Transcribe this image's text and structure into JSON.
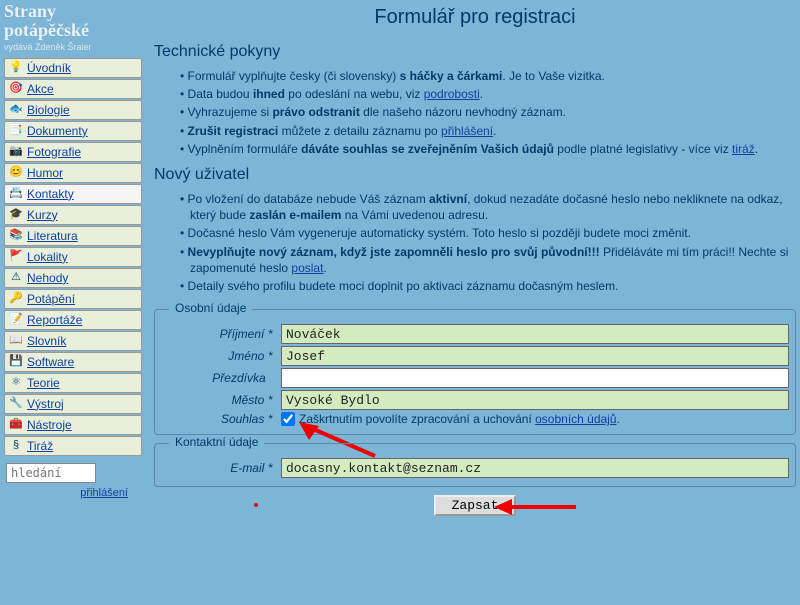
{
  "site": {
    "title_line1": "Strany",
    "title_line2": "potápěčské",
    "subtitle": "vydává Zdeněk Šraier"
  },
  "nav": [
    {
      "icon": "💡",
      "label": "Úvodník"
    },
    {
      "icon": "🎯",
      "label": "Akce"
    },
    {
      "icon": "🐟",
      "label": "Biologie"
    },
    {
      "icon": "📑",
      "label": "Dokumenty"
    },
    {
      "icon": "📷",
      "label": "Fotografie"
    },
    {
      "icon": "😊",
      "label": "Humor"
    },
    {
      "icon": "📇",
      "label": "Kontakty",
      "active": true
    },
    {
      "icon": "🎓",
      "label": "Kurzy"
    },
    {
      "icon": "📚",
      "label": "Literatura"
    },
    {
      "icon": "🚩",
      "label": "Lokality"
    },
    {
      "icon": "⚠",
      "label": "Nehody"
    },
    {
      "icon": "🔑",
      "label": "Potápění"
    },
    {
      "icon": "📝",
      "label": "Reportáže"
    },
    {
      "icon": "📖",
      "label": "Slovník"
    },
    {
      "icon": "💾",
      "label": "Software"
    },
    {
      "icon": "⚛",
      "label": "Teorie"
    },
    {
      "icon": "🔧",
      "label": "Výstroj"
    },
    {
      "icon": "🧰",
      "label": "Nástroje"
    },
    {
      "icon": "§",
      "label": "Tiráž"
    }
  ],
  "search_placeholder": "hledání",
  "login_link": "přihlášení",
  "page_title": "Formulář pro registraci",
  "tech": {
    "heading": "Technické pokyny",
    "li1a": "Formulář vyplňujte česky (či slovensky) ",
    "li1b": "s háčky a čárkami",
    "li1c": ". Je to Vaše vizitka.",
    "li2a": "Data budou ",
    "li2b": "ihned",
    "li2c": " po odeslání na webu, viz ",
    "li2d": "podrobosti",
    "li2e": ".",
    "li3a": "Vyhrazujeme si ",
    "li3b": "právo odstranit",
    "li3c": " dle našeho názoru nevhodný záznam.",
    "li4a": "Zrušit registraci",
    "li4b": " můžete z detailu záznamu po ",
    "li4c": "přihlášení",
    "li4d": ".",
    "li5a": "Vyplněním formuláře ",
    "li5b": "dáváte souhlas se zveřejněním Vašich údajů",
    "li5c": " podle platné legislativy - více viz ",
    "li5d": "tiráž",
    "li5e": "."
  },
  "newuser": {
    "heading": "Nový uživatel",
    "li1a": "Po vložení do databáze nebude Váš záznam ",
    "li1b": "aktivní",
    "li1c": ", dokud nezadáte dočasné heslo nebo nekliknete na odkaz, který bude ",
    "li1d": "zaslán e-mailem",
    "li1e": " na Vámi uvedenou adresu.",
    "li2": "Dočasné heslo Vám vygeneruje automaticky systém. Toto heslo si později budete moci změnit.",
    "li3a": "Nevyplňujte nový záznam, když jste zapomněli heslo pro svůj původní!!!",
    "li3b": " Přiděláváte mi tím práci!! Nechte si zapomenuté heslo ",
    "li3c": "poslat",
    "li3d": ".",
    "li4": "Detaily svého profilu budete moci doplnit po aktivaci záznamu dočasným heslem."
  },
  "form": {
    "personal_legend": "Osobní údaje",
    "surname_label": "Příjmení",
    "surname_value": "Nováček",
    "firstname_label": "Jméno",
    "firstname_value": "Josef",
    "nickname_label": "Přezdívka",
    "nickname_value": "",
    "city_label": "Město",
    "city_value": "Vysoké Bydlo",
    "consent_label": "Souhlas",
    "consent_text_a": "Zaškrtnutím povolíte zpracování a uchování ",
    "consent_text_link": "osobních údajů",
    "consent_text_b": ".",
    "contact_legend": "Kontaktní údaje",
    "email_label": "E-mail",
    "email_value": "docasny.kontakt@seznam.cz",
    "submit": "Zapsat",
    "asterisk": "*"
  }
}
